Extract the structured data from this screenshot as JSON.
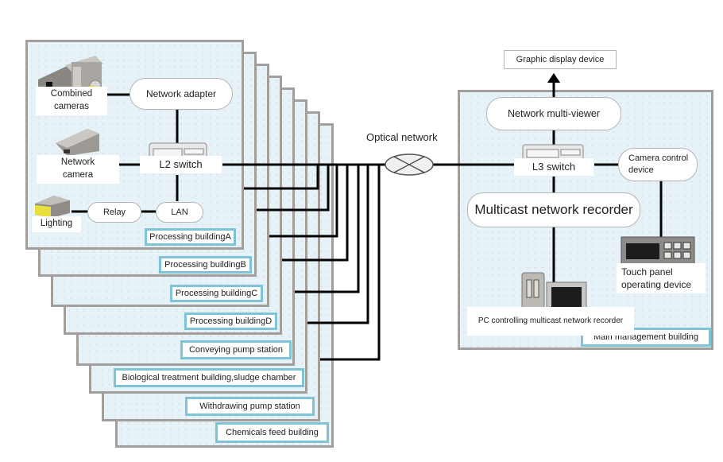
{
  "buildings": [
    {
      "label": "Processing buildingA"
    },
    {
      "label": "Processing buildingB"
    },
    {
      "label": "Processing buildingC"
    },
    {
      "label": "Processing buildingD"
    },
    {
      "label": "Conveying pump station"
    },
    {
      "label": "Biological treatment building,sludge chamber"
    },
    {
      "label": "Withdrawing pump station"
    },
    {
      "label": "Chemicals feed building"
    }
  ],
  "building_a": {
    "combined_cameras": "Combined\ncameras",
    "network_adapter": "Network adapter",
    "network_camera": "Network\ncamera",
    "l2_switch": "L2 switch",
    "lighting": "Lighting",
    "relay": "Relay",
    "lan": "LAN"
  },
  "network": {
    "optical_network": "Optical network"
  },
  "main_building": {
    "label": "Main management building",
    "graphic_display": "Graphic display device",
    "multi_viewer": "Network multi-viewer",
    "l3_switch": "L3 switch",
    "camera_control": "Camera control\ndevice",
    "multicast_recorder": "Multicast network recorder",
    "touch_panel": "Touch panel\noperating device",
    "pc_controlling": "PC controlling multicast network recorder"
  },
  "colors": {
    "panel_bg": "#e6f3f8",
    "panel_border": "#a29e9b",
    "label_border": "#7fc4d6",
    "line": "#000000"
  }
}
